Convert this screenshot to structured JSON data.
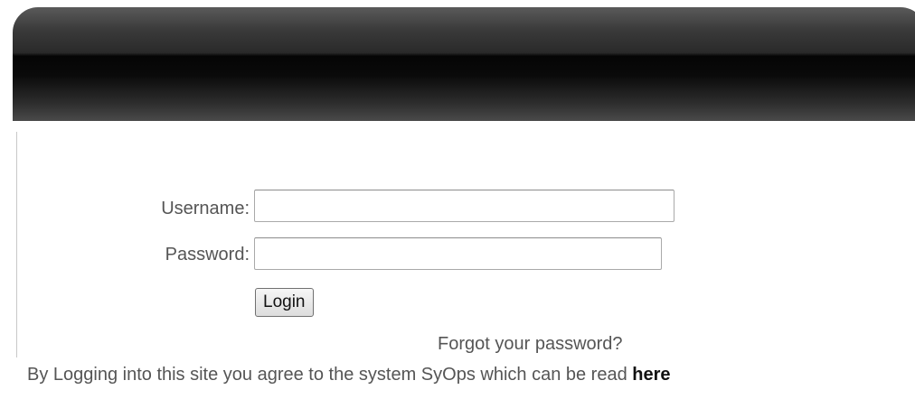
{
  "login_form": {
    "username_label": "Username:",
    "username_value": "",
    "password_label": "Password:",
    "password_value": "",
    "login_button": "Login",
    "forgot_password_link": "Forgot your password?"
  },
  "notice": {
    "text": "By Logging into this site you agree to the system SyOps which can be read ",
    "link_text": "here"
  },
  "colors": {
    "header_dark": "#050505",
    "label_text": "#555555",
    "link_bold": "#111111"
  }
}
